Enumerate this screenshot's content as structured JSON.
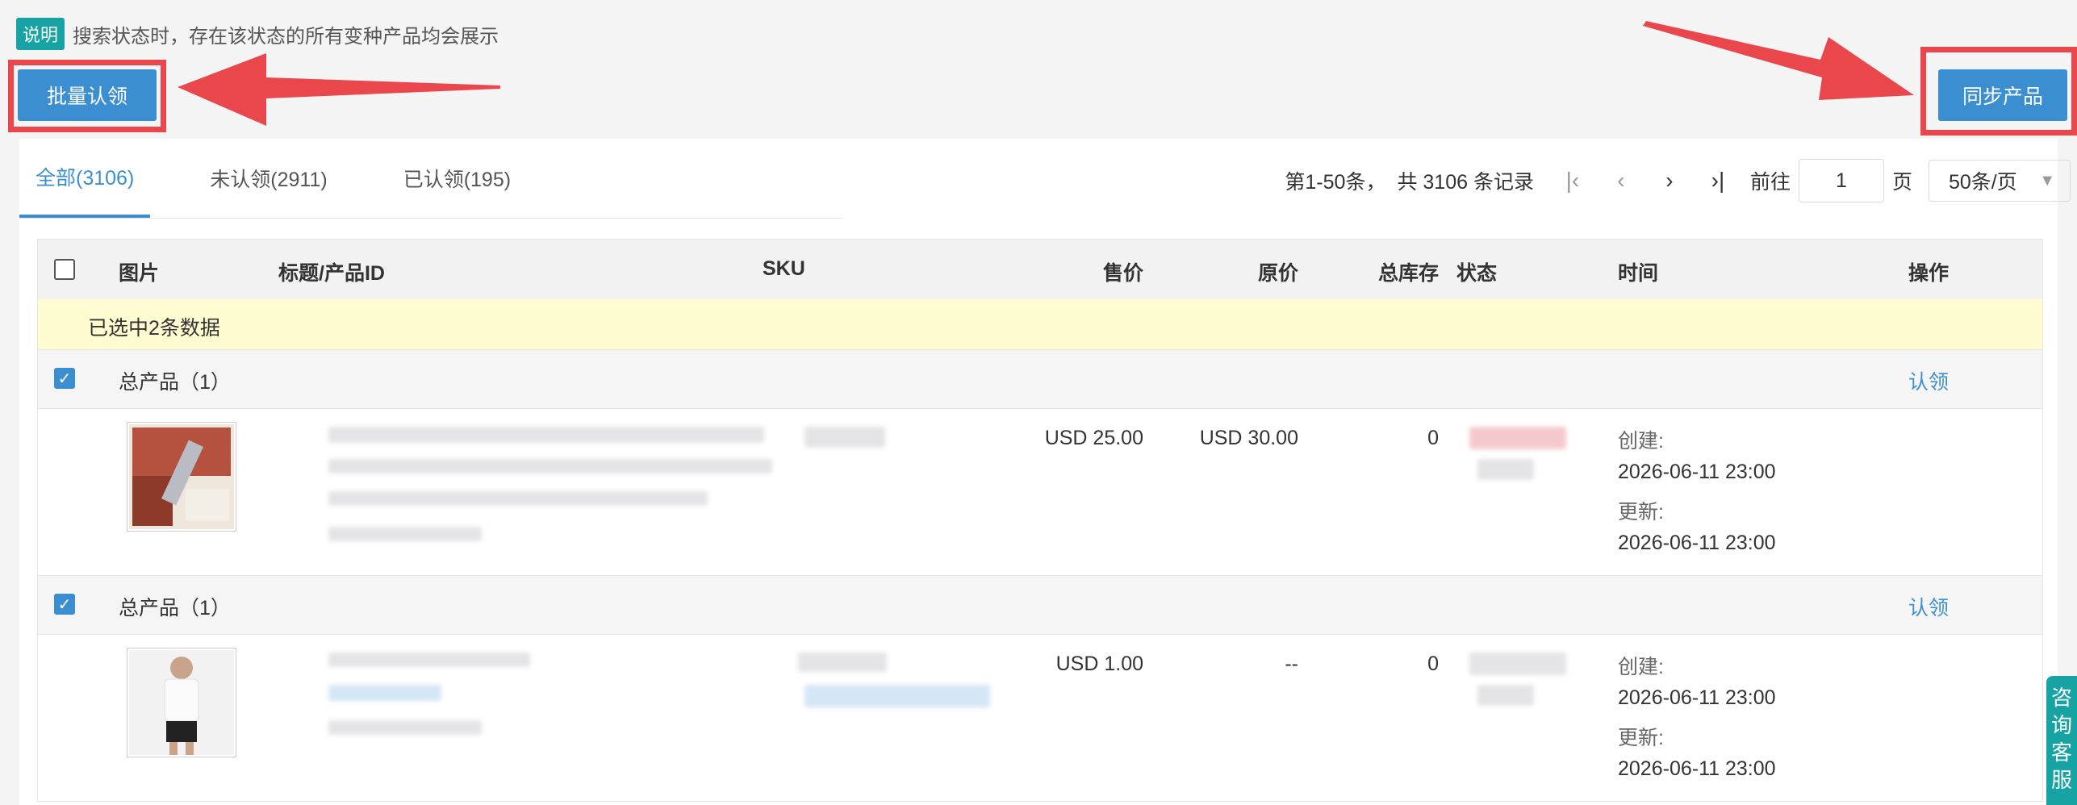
{
  "notice": {
    "tag": "说明",
    "text": "搜索状态时，存在该状态的所有变种产品均会展示"
  },
  "buttons": {
    "batch_claim": "批量认领",
    "sync_products": "同步产品"
  },
  "tabs": [
    {
      "label": "全部(3106)",
      "active": true
    },
    {
      "label": "未认领(2911)",
      "active": false
    },
    {
      "label": "已认领(195)",
      "active": false
    }
  ],
  "pager": {
    "range": "第1-50条，",
    "total": "共 3106 条记录",
    "goto_label": "前往",
    "page_value": "1",
    "page_unit": "页",
    "page_size": "50条/页"
  },
  "table": {
    "headers": {
      "image": "图片",
      "title": "标题/产品ID",
      "sku": "SKU",
      "price": "售价",
      "orig_price": "原价",
      "stock": "总库存",
      "status": "状态",
      "time": "时间",
      "action": "操作"
    },
    "selected_text": "已选中2条数据",
    "groups": [
      {
        "label": "总产品（1）",
        "action": "认领",
        "checked": true,
        "product": {
          "price": "USD 25.00",
          "orig_price": "USD 30.00",
          "stock": "0",
          "created_label": "创建:",
          "created": "2026-06-11 23:00",
          "updated_label": "更新:",
          "updated": "2026-06-11 23:00"
        }
      },
      {
        "label": "总产品（1）",
        "action": "认领",
        "checked": true,
        "product": {
          "price": "USD 1.00",
          "orig_price": "--",
          "stock": "0",
          "created_label": "创建:",
          "created": "2026-06-11 23:00",
          "updated_label": "更新:",
          "updated": "2026-06-11 23:00"
        }
      }
    ]
  },
  "side_tab": {
    "label_1": "咨",
    "label_2": "询",
    "label_3": "客",
    "label_4": "服"
  },
  "colors": {
    "accent": "#3b8fd1",
    "teal": "#17a2a4",
    "annotation_red": "#e9474b",
    "selected_bar": "#fffcd2"
  }
}
